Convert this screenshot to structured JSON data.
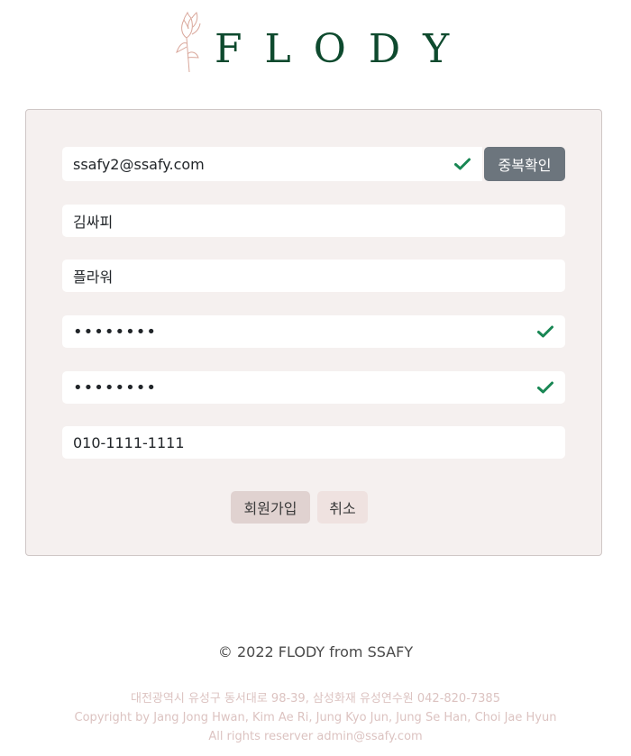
{
  "brand": {
    "name": "FLODY"
  },
  "form": {
    "email": "ssafy2@ssafy.com",
    "duplicate_check_label": "중복확인",
    "name": "김싸피",
    "nickname": "플라워",
    "password": "••••••••",
    "password_confirm": "••••••••",
    "phone": "010-1111-1111",
    "signup_label": "회원가입",
    "cancel_label": "취소"
  },
  "colors": {
    "accent_green": "#198754",
    "brand_green": "#0e4a2e",
    "card_bg": "#f5f0ef"
  },
  "footer": {
    "copyright": "© 2022 FLODY from SSAFY",
    "address": "대전광역시 유성구 동서대로 98-39, 삼성화재 유성연수원 042-820-7385",
    "credits": "Copyright by Jang Jong Hwan, Kim Ae Ri, Jung Kyo Jun, Jung Se Han, Choi Jae Hyun",
    "rights": "All rights reserver admin@ssafy.com"
  }
}
